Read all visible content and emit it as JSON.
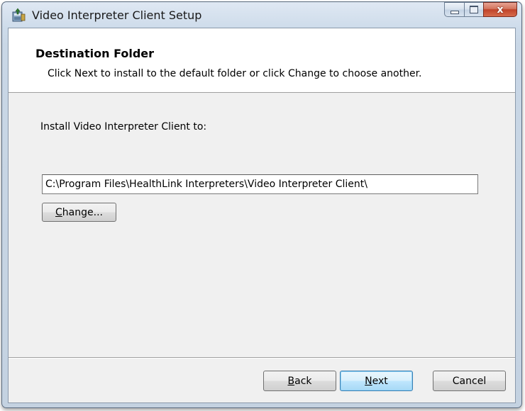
{
  "window": {
    "title": "Video Interpreter Client Setup",
    "close_glyph": "x"
  },
  "header": {
    "title": "Destination Folder",
    "subtitle": "Click Next to install to the default folder or click Change to choose another."
  },
  "body": {
    "install_label": "Install Video Interpreter Client to:",
    "install_path": "C:\\Program Files\\HealthLink Interpreters\\Video Interpreter Client\\"
  },
  "buttons": {
    "change_first": "C",
    "change_rest": "hange...",
    "back_first": "B",
    "back_rest": "ack",
    "next_first": "N",
    "next_rest": "ext",
    "cancel": "Cancel"
  },
  "colors": {
    "titlebar": "#cddbea",
    "close_button": "#c0432a",
    "default_button_border": "#3c7fb1"
  },
  "icons": [
    "installer-icon",
    "minimize-icon",
    "maximize-icon",
    "close-icon"
  ]
}
